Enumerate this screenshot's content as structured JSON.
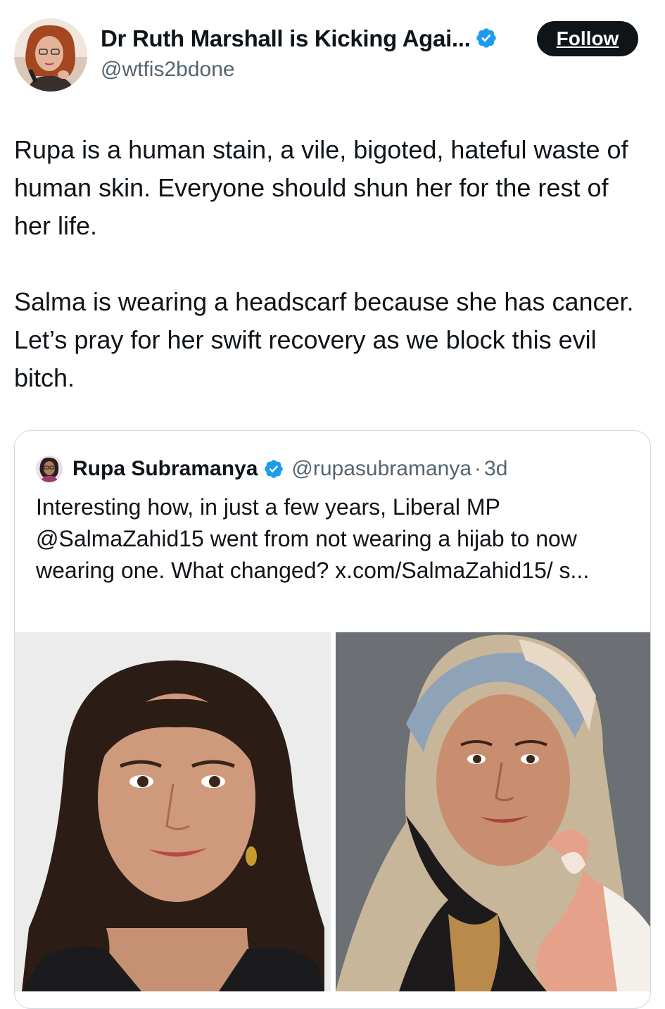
{
  "tweet": {
    "author": {
      "name": "Dr Ruth Marshall is Kicking Agai...",
      "handle": "@wtfis2bdone",
      "verified": true,
      "avatar_icon": "profile-photo"
    },
    "follow_label": "Follow",
    "body": [
      "Rupa is a human stain, a vile, bigoted, hateful waste of human skin. Everyone should shun her for the rest of her life.",
      "Salma is wearing a headscarf because she has cancer. Let’s pray for her swift recovery as we block this evil bitch."
    ],
    "quote": {
      "author_name": "Rupa Subramanya",
      "handle": "@rupasubramanya",
      "separator": "·",
      "time": "3d",
      "verified": true,
      "text": "Interesting how, in just a few years, Liberal MP @SalmaZahid15 went from not wearing a hijab to now wearing one. What changed? x.com/SalmaZahid15/ s...",
      "images": [
        "portrait-without-hijab",
        "portrait-with-hijab"
      ]
    }
  },
  "colors": {
    "text": "#0f1419",
    "secondary": "#536471",
    "verified": "#1d9bf0",
    "border": "#cfd9de",
    "button_bg": "#0f1419",
    "button_text": "#ffffff"
  }
}
